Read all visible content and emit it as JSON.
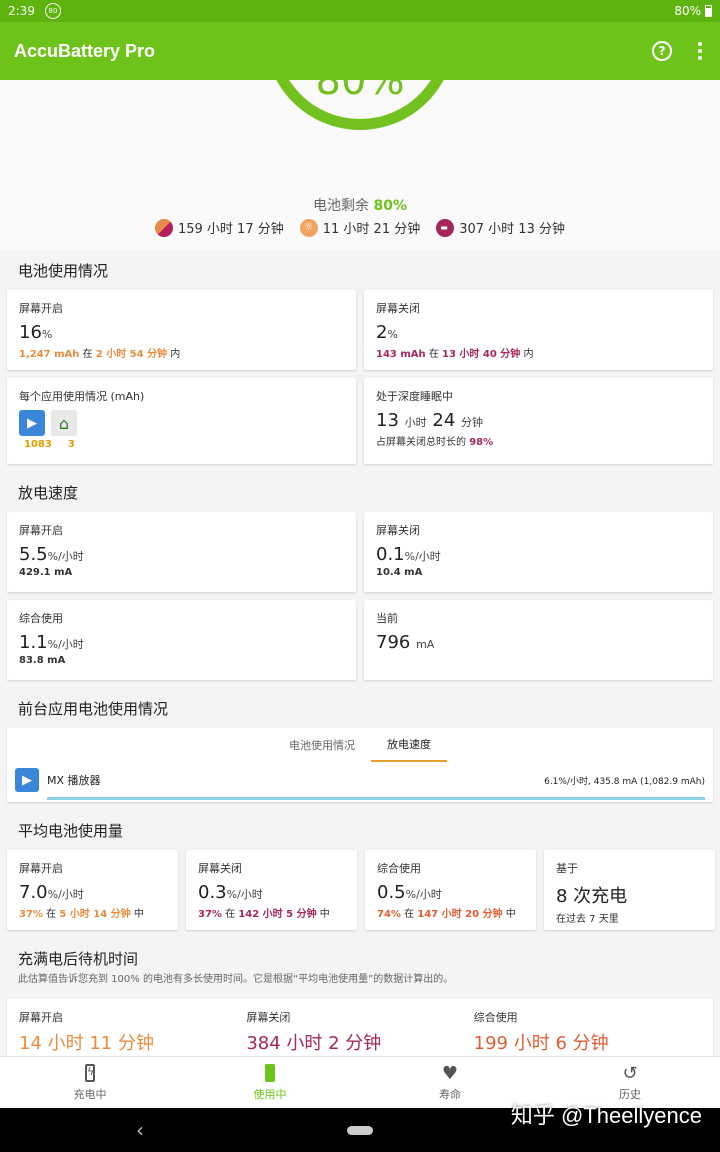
{
  "status_bar": {
    "time": "2:39",
    "badge": "80",
    "battery": "80%"
  },
  "app_bar": {
    "title": "AccuBattery Pro",
    "help_label": "?"
  },
  "summary": {
    "ring_value": "80%",
    "remaining_label": "电池剩余",
    "remaining_value": "80%",
    "estimates": [
      {
        "icon": "combined-usage-icon",
        "text": "159 小时 17 分钟"
      },
      {
        "icon": "screen-on-icon",
        "text": "11 小时 21 分钟"
      },
      {
        "icon": "deep-sleep-icon",
        "text": "307 小时 13 分钟"
      }
    ]
  },
  "usage": {
    "title": "电池使用情况",
    "screen_on": {
      "label": "屏幕开启",
      "value": "16",
      "unit": "%",
      "mah": "1,247 mAh",
      "in": "在",
      "duration": "2 小时 54 分钟",
      "suffix": "内"
    },
    "screen_off": {
      "label": "屏幕关闭",
      "value": "2",
      "unit": "%",
      "mah": "143 mAh",
      "in": "在",
      "duration": "13 小时 40 分钟",
      "suffix": "内"
    },
    "per_app": {
      "label": "每个应用使用情况 (mAh)",
      "apps": [
        {
          "icon": "mx-player-icon",
          "value": "1083"
        },
        {
          "icon": "launcher-home-icon",
          "value": "3"
        }
      ]
    },
    "deep_sleep": {
      "label": "处于深度睡眠中",
      "hours": "13",
      "hours_unit": "小时",
      "minutes": "24",
      "minutes_unit": "分钟",
      "note": "占屏幕关闭总时长的",
      "percent": "98%"
    }
  },
  "discharge": {
    "title": "放电速度",
    "screen_on": {
      "label": "屏幕开启",
      "value": "5.5",
      "unit": "%/小时",
      "ma": "429.1 mA"
    },
    "screen_off": {
      "label": "屏幕关闭",
      "value": "0.1",
      "unit": "%/小时",
      "ma": "10.4 mA"
    },
    "combined": {
      "label": "综合使用",
      "value": "1.1",
      "unit": "%/小时",
      "ma": "83.8 mA"
    },
    "current": {
      "label": "当前",
      "value": "796",
      "unit": "mA"
    }
  },
  "foreground": {
    "title": "前台应用电池使用情况",
    "tabs": [
      "电池使用情况",
      "放电速度"
    ],
    "app_name": "MX 播放器",
    "app_value": "6.1%/小时, 435.8 mA (1,082.9 mAh)"
  },
  "average": {
    "title": "平均电池使用量",
    "screen_on": {
      "label": "屏幕开启",
      "value": "7.0",
      "unit": "%/小时",
      "pct": "37%",
      "in": "在",
      "duration": "5 小时 14 分钟",
      "suffix": "中"
    },
    "screen_off": {
      "label": "屏幕关闭",
      "value": "0.3",
      "unit": "%/小时",
      "pct": "37%",
      "in": "在",
      "duration": "142 小时 5 分钟",
      "suffix": "中"
    },
    "combined": {
      "label": "综合使用",
      "value": "0.5",
      "unit": "%/小时",
      "pct": "74%",
      "in": "在",
      "duration": "147 小时 20 分钟",
      "suffix": "中"
    },
    "based_on": {
      "label": "基于",
      "value": "8 次充电",
      "note": "在过去 7 天里"
    }
  },
  "standby": {
    "title": "充满电后待机时间",
    "description": "此估算值告诉您充到 100% 的电池有多长使用时间。它是根据“平均电池使用量”的数据计算出的。",
    "screen_on": {
      "label": "屏幕开启",
      "value": "14 小时 11 分钟"
    },
    "screen_off": {
      "label": "屏幕关闭",
      "value": "384 小时 2 分钟"
    },
    "combined": {
      "label": "综合使用",
      "value": "199 小时 6 分钟"
    }
  },
  "bottom_nav": {
    "items": [
      "充电中",
      "使用中",
      "寿命",
      "历史"
    ],
    "active": "使用中"
  },
  "watermark": "知乎 @Theellyence",
  "colors": {
    "brand_green": "#6ec31a",
    "orange": "#ea8c3e",
    "purple": "#a6285d",
    "red": "#e35d32"
  }
}
